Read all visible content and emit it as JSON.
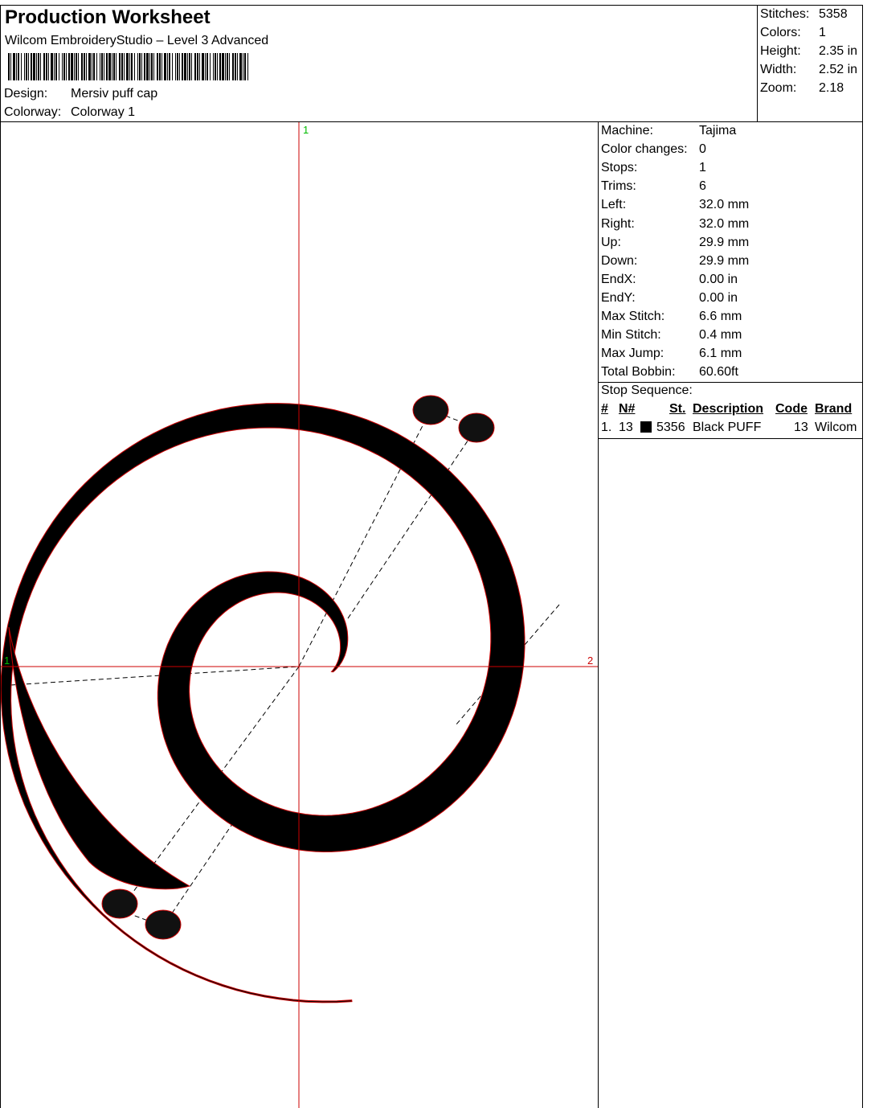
{
  "header": {
    "title": "Production Worksheet",
    "subtitle": "Wilcom EmbroideryStudio – Level 3 Advanced",
    "design_label": "Design:",
    "design_value": "Mersiv puff cap",
    "colorway_label": "Colorway:",
    "colorway_value": "Colorway 1"
  },
  "summary": {
    "stitches_label": "Stitches:",
    "stitches_value": "5358",
    "colors_label": "Colors:",
    "colors_value": "1",
    "height_label": "Height:",
    "height_value": "2.35 in",
    "width_label": "Width:",
    "width_value": "2.52 in",
    "zoom_label": "Zoom:",
    "zoom_value": "2.18"
  },
  "stats": [
    {
      "label": "Machine:",
      "value": "Tajima"
    },
    {
      "label": "Color changes:",
      "value": "0"
    },
    {
      "label": "Stops:",
      "value": "1"
    },
    {
      "label": "Trims:",
      "value": "6"
    },
    {
      "label": "Left:",
      "value": "32.0 mm"
    },
    {
      "label": "Right:",
      "value": "32.0 mm"
    },
    {
      "label": "Up:",
      "value": "29.9 mm"
    },
    {
      "label": "Down:",
      "value": "29.9 mm"
    },
    {
      "label": "EndX:",
      "value": "0.00 in"
    },
    {
      "label": "EndY:",
      "value": "0.00 in"
    },
    {
      "label": "Max Stitch:",
      "value": "6.6 mm"
    },
    {
      "label": "Min Stitch:",
      "value": "0.4 mm"
    },
    {
      "label": "Max Jump:",
      "value": "6.1 mm"
    },
    {
      "label": "Total Bobbin:",
      "value": "60.60ft"
    }
  ],
  "stop_sequence": {
    "title": "Stop Sequence:",
    "columns": [
      "#",
      "N#",
      "St.",
      "Description",
      "Code",
      "Brand"
    ],
    "rows": [
      {
        "num": "1.",
        "needle": "13",
        "swatch": "#000000",
        "stitches": "5356",
        "description": "Black PUFF",
        "code": "13",
        "brand": "Wilcom"
      }
    ]
  },
  "design_view": {
    "axis_top_label": "1",
    "axis_left_label": "1",
    "axis_right_label": "2",
    "axis_color": "#cc0000",
    "marker_color": "#00bb00",
    "outline_color": "#cc0000",
    "fill_color": "#000000"
  }
}
